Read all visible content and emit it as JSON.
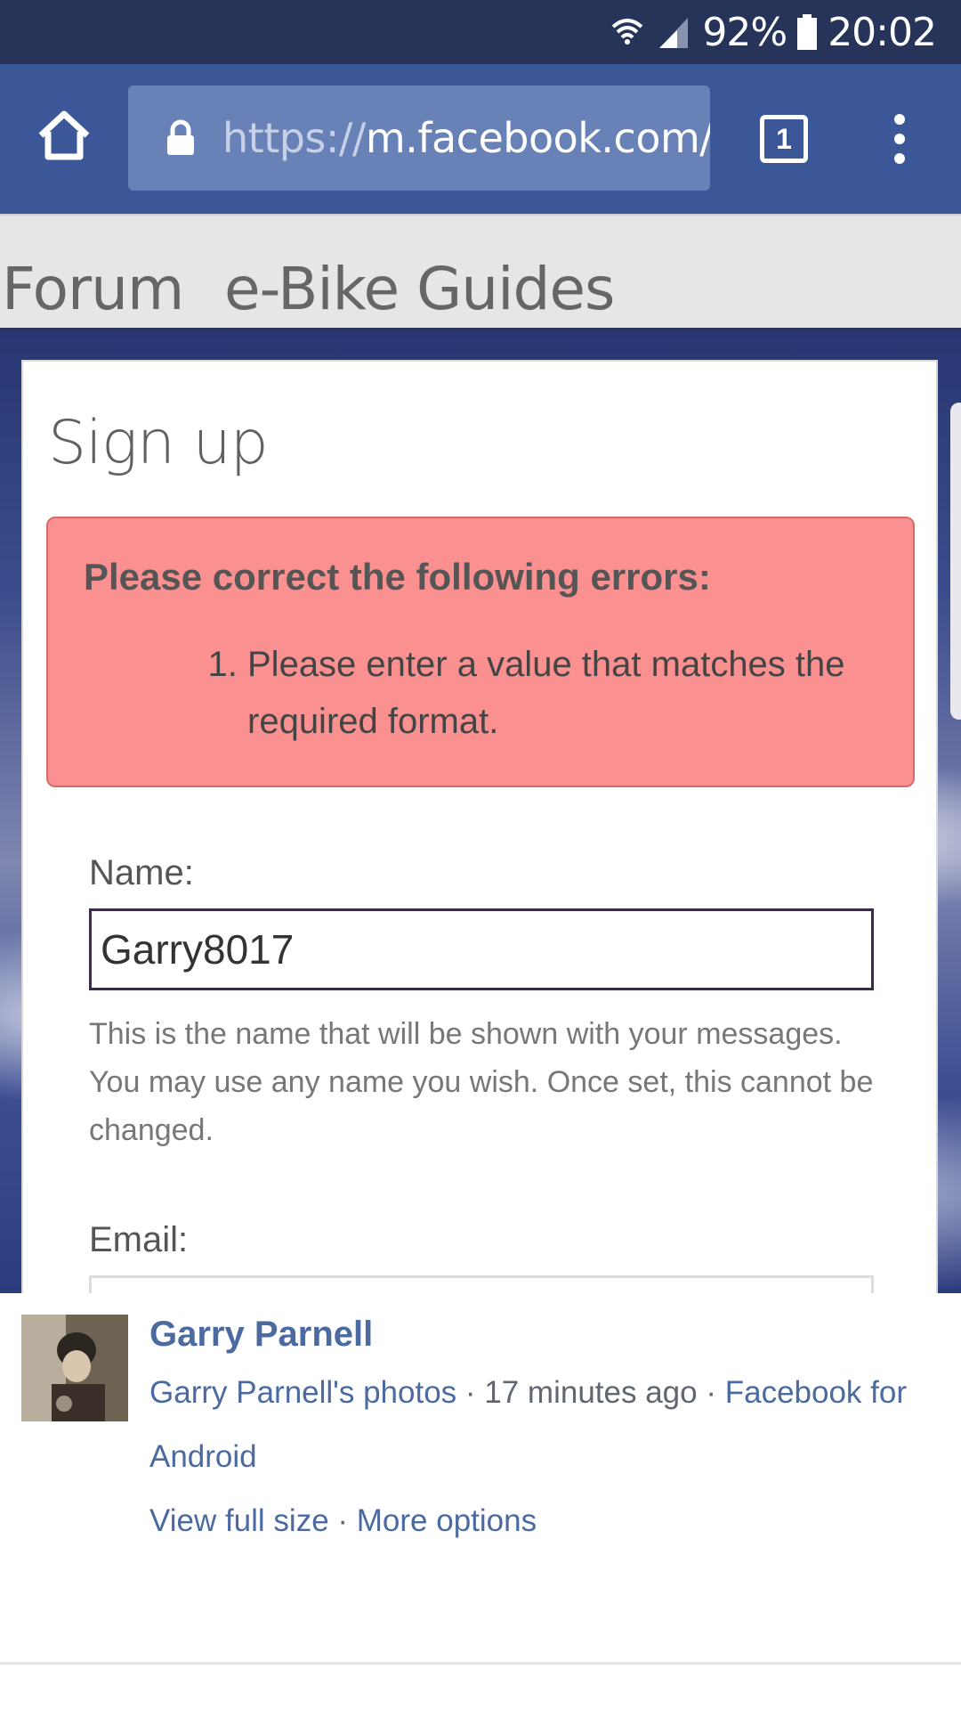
{
  "status_bar": {
    "battery": "92%",
    "time": "20:02"
  },
  "browser": {
    "url_scheme": "https://",
    "url_host": "m.facebook.com/",
    "tab_count": "1"
  },
  "site_nav": {
    "items": [
      "Forum",
      "e-Bike Guides"
    ]
  },
  "signup": {
    "title": "Sign up",
    "error_heading": "Please correct the following errors:",
    "errors": [
      "Please enter a value that matches the required format."
    ],
    "name_label": "Name:",
    "name_value": "Garry8017",
    "name_help": "This is the name that will be shown with your messages. You may use any name you wish. Once set, this cannot be changed.",
    "email_label": "Email:"
  },
  "post": {
    "author": "Garry Parnell",
    "album_link": "Garry Parnell's photos",
    "separator": " · ",
    "time": "17 minutes ago",
    "app_link": "Facebook for Android",
    "view_full_size": "View full size",
    "more_options": "More options"
  },
  "colors": {
    "status_bar": "#26345a",
    "browser_bar": "#3b5797",
    "error_bg": "#fa9090",
    "link": "#4b6aa0"
  }
}
